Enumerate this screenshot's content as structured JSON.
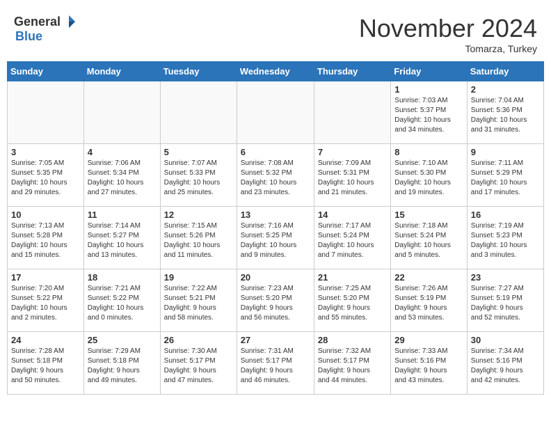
{
  "header": {
    "logo_general": "General",
    "logo_blue": "Blue",
    "month": "November 2024",
    "location": "Tomarza, Turkey"
  },
  "weekdays": [
    "Sunday",
    "Monday",
    "Tuesday",
    "Wednesday",
    "Thursday",
    "Friday",
    "Saturday"
  ],
  "weeks": [
    [
      {
        "day": "",
        "info": ""
      },
      {
        "day": "",
        "info": ""
      },
      {
        "day": "",
        "info": ""
      },
      {
        "day": "",
        "info": ""
      },
      {
        "day": "",
        "info": ""
      },
      {
        "day": "1",
        "info": "Sunrise: 7:03 AM\nSunset: 5:37 PM\nDaylight: 10 hours\nand 34 minutes."
      },
      {
        "day": "2",
        "info": "Sunrise: 7:04 AM\nSunset: 5:36 PM\nDaylight: 10 hours\nand 31 minutes."
      }
    ],
    [
      {
        "day": "3",
        "info": "Sunrise: 7:05 AM\nSunset: 5:35 PM\nDaylight: 10 hours\nand 29 minutes."
      },
      {
        "day": "4",
        "info": "Sunrise: 7:06 AM\nSunset: 5:34 PM\nDaylight: 10 hours\nand 27 minutes."
      },
      {
        "day": "5",
        "info": "Sunrise: 7:07 AM\nSunset: 5:33 PM\nDaylight: 10 hours\nand 25 minutes."
      },
      {
        "day": "6",
        "info": "Sunrise: 7:08 AM\nSunset: 5:32 PM\nDaylight: 10 hours\nand 23 minutes."
      },
      {
        "day": "7",
        "info": "Sunrise: 7:09 AM\nSunset: 5:31 PM\nDaylight: 10 hours\nand 21 minutes."
      },
      {
        "day": "8",
        "info": "Sunrise: 7:10 AM\nSunset: 5:30 PM\nDaylight: 10 hours\nand 19 minutes."
      },
      {
        "day": "9",
        "info": "Sunrise: 7:11 AM\nSunset: 5:29 PM\nDaylight: 10 hours\nand 17 minutes."
      }
    ],
    [
      {
        "day": "10",
        "info": "Sunrise: 7:13 AM\nSunset: 5:28 PM\nDaylight: 10 hours\nand 15 minutes."
      },
      {
        "day": "11",
        "info": "Sunrise: 7:14 AM\nSunset: 5:27 PM\nDaylight: 10 hours\nand 13 minutes."
      },
      {
        "day": "12",
        "info": "Sunrise: 7:15 AM\nSunset: 5:26 PM\nDaylight: 10 hours\nand 11 minutes."
      },
      {
        "day": "13",
        "info": "Sunrise: 7:16 AM\nSunset: 5:25 PM\nDaylight: 10 hours\nand 9 minutes."
      },
      {
        "day": "14",
        "info": "Sunrise: 7:17 AM\nSunset: 5:24 PM\nDaylight: 10 hours\nand 7 minutes."
      },
      {
        "day": "15",
        "info": "Sunrise: 7:18 AM\nSunset: 5:24 PM\nDaylight: 10 hours\nand 5 minutes."
      },
      {
        "day": "16",
        "info": "Sunrise: 7:19 AM\nSunset: 5:23 PM\nDaylight: 10 hours\nand 3 minutes."
      }
    ],
    [
      {
        "day": "17",
        "info": "Sunrise: 7:20 AM\nSunset: 5:22 PM\nDaylight: 10 hours\nand 2 minutes."
      },
      {
        "day": "18",
        "info": "Sunrise: 7:21 AM\nSunset: 5:22 PM\nDaylight: 10 hours\nand 0 minutes."
      },
      {
        "day": "19",
        "info": "Sunrise: 7:22 AM\nSunset: 5:21 PM\nDaylight: 9 hours\nand 58 minutes."
      },
      {
        "day": "20",
        "info": "Sunrise: 7:23 AM\nSunset: 5:20 PM\nDaylight: 9 hours\nand 56 minutes."
      },
      {
        "day": "21",
        "info": "Sunrise: 7:25 AM\nSunset: 5:20 PM\nDaylight: 9 hours\nand 55 minutes."
      },
      {
        "day": "22",
        "info": "Sunrise: 7:26 AM\nSunset: 5:19 PM\nDaylight: 9 hours\nand 53 minutes."
      },
      {
        "day": "23",
        "info": "Sunrise: 7:27 AM\nSunset: 5:19 PM\nDaylight: 9 hours\nand 52 minutes."
      }
    ],
    [
      {
        "day": "24",
        "info": "Sunrise: 7:28 AM\nSunset: 5:18 PM\nDaylight: 9 hours\nand 50 minutes."
      },
      {
        "day": "25",
        "info": "Sunrise: 7:29 AM\nSunset: 5:18 PM\nDaylight: 9 hours\nand 49 minutes."
      },
      {
        "day": "26",
        "info": "Sunrise: 7:30 AM\nSunset: 5:17 PM\nDaylight: 9 hours\nand 47 minutes."
      },
      {
        "day": "27",
        "info": "Sunrise: 7:31 AM\nSunset: 5:17 PM\nDaylight: 9 hours\nand 46 minutes."
      },
      {
        "day": "28",
        "info": "Sunrise: 7:32 AM\nSunset: 5:17 PM\nDaylight: 9 hours\nand 44 minutes."
      },
      {
        "day": "29",
        "info": "Sunrise: 7:33 AM\nSunset: 5:16 PM\nDaylight: 9 hours\nand 43 minutes."
      },
      {
        "day": "30",
        "info": "Sunrise: 7:34 AM\nSunset: 5:16 PM\nDaylight: 9 hours\nand 42 minutes."
      }
    ]
  ]
}
